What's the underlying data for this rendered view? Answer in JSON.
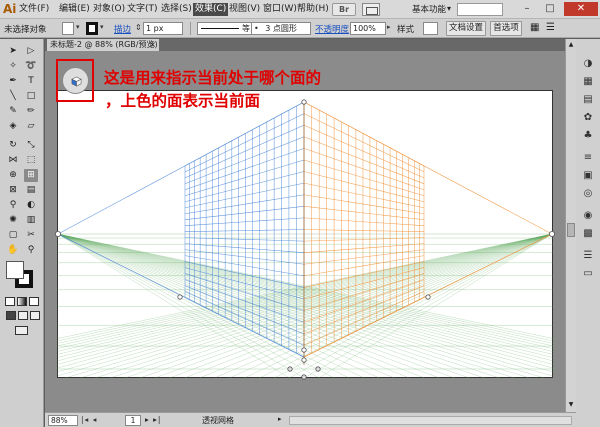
{
  "app": {
    "logo": "Ai",
    "bridge": "Br"
  },
  "menu": {
    "items": [
      "文件(F)",
      "编辑(E)",
      "对象(O)",
      "文字(T)",
      "选择(S)",
      "效果(C)",
      "视图(V)",
      "窗口(W)",
      "帮助(H)"
    ],
    "active_index": 5,
    "workspace": "基本功能",
    "minimize": "–",
    "maximize": "□",
    "close": "✕"
  },
  "control": {
    "selection_state": "未选择对象",
    "stroke_label": "描边",
    "stroke_weight": "1 px",
    "profile_label": "等比",
    "brush": "3 点圆形",
    "opacity_label": "不透明度",
    "opacity_value": "100%",
    "style_label": "样式",
    "doc_setup": "文档设置",
    "preferences": "首选项"
  },
  "document": {
    "tab_title": "未标题-2 @ 88% (RGB/预览)",
    "tab_close": "×"
  },
  "annotation": {
    "line1": "这是用来指示当前处于哪个面的",
    "line2": "，上色的面表示当前面"
  },
  "status": {
    "zoom": "88%",
    "page": "1",
    "tool_name": "透视网格"
  },
  "colors": {
    "left_grid": "#4a86d6",
    "right_grid": "#f0923a",
    "ground_grid": "#5aa85a",
    "annotation": "#e00000"
  }
}
